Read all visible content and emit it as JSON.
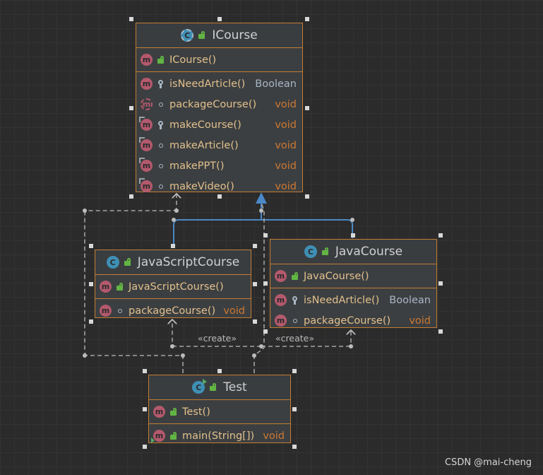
{
  "colors": {
    "background": "#2b2b2b",
    "node_fill": "#3c3f41",
    "node_border": "#c27d33",
    "member_name": "#e2c08d",
    "void_type": "#cc7832",
    "method_icon": "#b4596d",
    "class_icon": "#3f8fb5",
    "realization_edge": "#4a88c7",
    "dependency_edge": "#bcbcbc"
  },
  "nodes": {
    "icourse": {
      "icon": "abstract-class-icon",
      "icon_letter": "C",
      "title": "ICourse",
      "constructor": {
        "icon_letter": "m",
        "name": "ICourse()"
      },
      "methods": [
        {
          "name": "isNeedArticle()",
          "type": "Boolean",
          "visibility": "protected",
          "icon_style": "normal"
        },
        {
          "name": "packageCourse()",
          "type": "void",
          "visibility": "package",
          "icon_style": "abstract"
        },
        {
          "name": "makeCourse()",
          "type": "void",
          "visibility": "protected",
          "icon_style": "override"
        },
        {
          "name": "makeArticle()",
          "type": "void",
          "visibility": "package",
          "icon_style": "override"
        },
        {
          "name": "makePPT()",
          "type": "void",
          "visibility": "package",
          "icon_style": "override"
        },
        {
          "name": "makeVideo()",
          "type": "void",
          "visibility": "package",
          "icon_style": "override"
        }
      ]
    },
    "javascriptcourse": {
      "icon": "class-icon",
      "icon_letter": "C",
      "title": "JavaScriptCourse",
      "constructor": {
        "icon_letter": "m",
        "name": "JavaScriptCourse()"
      },
      "methods": [
        {
          "name": "packageCourse()",
          "type": "void",
          "visibility": "package",
          "icon_style": "normal"
        }
      ]
    },
    "javacourse": {
      "icon": "class-icon",
      "icon_letter": "C",
      "title": "JavaCourse",
      "constructor": {
        "icon_letter": "m",
        "name": "JavaCourse()"
      },
      "methods": [
        {
          "name": "isNeedArticle()",
          "type": "Boolean",
          "visibility": "protected",
          "icon_style": "normal"
        },
        {
          "name": "packageCourse()",
          "type": "void",
          "visibility": "package",
          "icon_style": "normal"
        }
      ]
    },
    "test": {
      "icon": "runnable-class-icon",
      "icon_letter": "C",
      "title": "Test",
      "constructor": {
        "icon_letter": "m",
        "name": "Test()"
      },
      "methods": [
        {
          "name": "main(String[])",
          "type": "void",
          "visibility": "public",
          "icon_style": "run"
        }
      ]
    }
  },
  "edge_labels": {
    "create_left": "«create»",
    "create_right": "«create»"
  },
  "watermark": "CSDN @mai-cheng"
}
